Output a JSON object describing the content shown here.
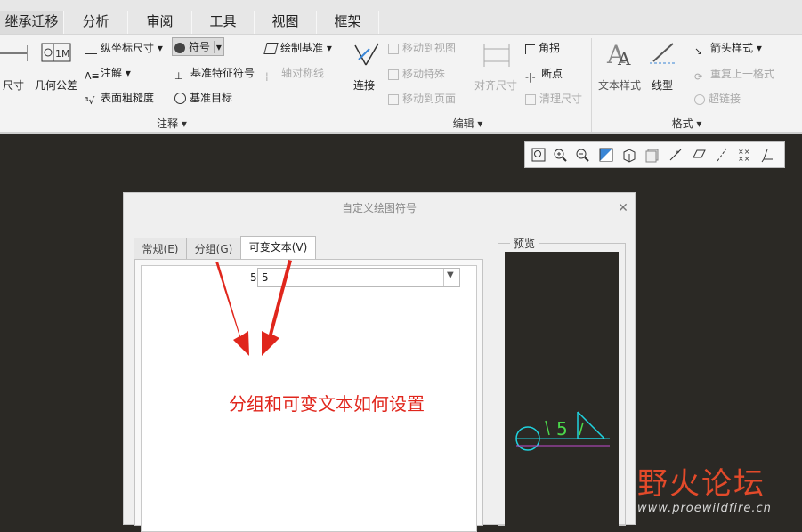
{
  "ribbon_tabs": [
    "继承迁移",
    "分析",
    "审阅",
    "工具",
    "视图",
    "框架"
  ],
  "annotate_group": {
    "left_items": [
      "尺寸",
      "几何公差"
    ],
    "col1": [
      "纵坐标尺寸",
      "注解",
      "表面粗糙度"
    ],
    "col2": [
      "符号",
      "基准特征符号",
      "基准目标"
    ],
    "col3": [
      "绘制基准",
      "轴对称线"
    ],
    "label": "注释"
  },
  "edit_group": {
    "connect": "连接",
    "move_items": [
      "移动到视图",
      "移动特殊",
      "移动到页面"
    ],
    "align": "对齐尺寸",
    "right_items": [
      "角拐",
      "断点",
      "清理尺寸"
    ],
    "label": "编辑"
  },
  "format_group": {
    "text_style": "文本样式",
    "line_style": "线型",
    "items": [
      "箭头样式",
      "重复上一格式",
      "超链接"
    ],
    "label": "格式"
  },
  "dialog": {
    "title": "自定义绘图符号",
    "tabs": [
      "常规(E)",
      "分组(G)",
      "可变文本(V)"
    ],
    "row_label": "5",
    "row_value": "5",
    "preview_label": "预览",
    "preview_text": "5"
  },
  "annotation_text": "分组和可变文本如何设置",
  "watermark": {
    "title": "野火论坛",
    "url": "www.proewildfire.cn"
  },
  "colors": {
    "canvas": "#2b2925",
    "annotation": "#e0261c",
    "preview_circle": "#1fd3e0",
    "preview_text": "#4bd84b",
    "preview_line": "#c04bd0"
  }
}
